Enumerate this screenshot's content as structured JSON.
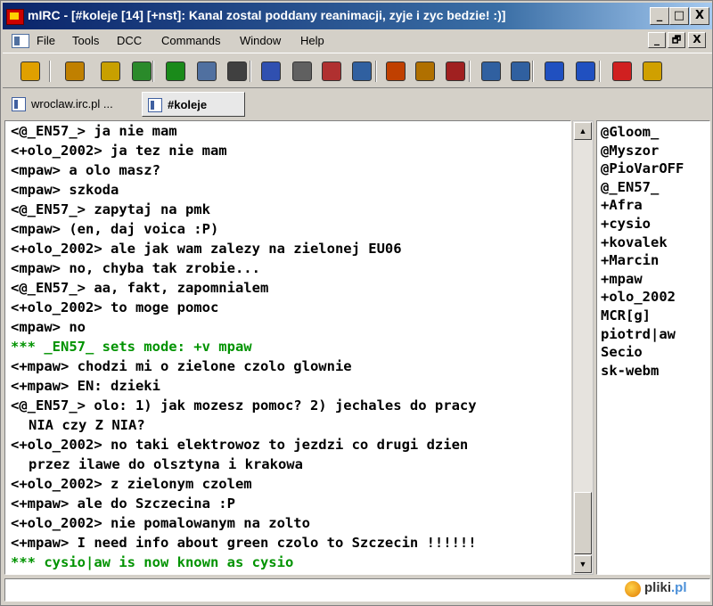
{
  "window": {
    "title": "mIRC - [#koleje [14] [+nst]: Kanal zostal poddany reanimacji, zyje i zyc bedzie! :)]",
    "controls": [
      "_",
      "□",
      "X"
    ],
    "child_controls": [
      "_",
      "🗗",
      "X"
    ]
  },
  "menu": [
    "File",
    "Tools",
    "DCC",
    "Commands",
    "Window",
    "Help"
  ],
  "toolbar": {
    "buttons": [
      {
        "name": "connect-icon",
        "color": "#e0a000"
      },
      {
        "name": "options-icon",
        "color": "#c08000"
      },
      {
        "name": "channels-folder-icon",
        "color": "#c8a000"
      },
      {
        "name": "favorites-icon",
        "color": "#2a8a2a"
      },
      {
        "name": "address-book-icon",
        "color": "#1a8a1a"
      },
      {
        "name": "dcc-send-icon",
        "color": "#5070a0"
      },
      {
        "name": "dcc-chat-icon",
        "color": "#404040"
      },
      {
        "name": "scripts-icon",
        "color": "#3050b0"
      },
      {
        "name": "timer-icon",
        "color": "#606060"
      },
      {
        "name": "colors-icon",
        "color": "#b03030"
      },
      {
        "name": "tile-icon",
        "color": "#3060a0"
      },
      {
        "name": "notify-icon",
        "color": "#c04000"
      },
      {
        "name": "url-list-icon",
        "color": "#b07000"
      },
      {
        "name": "log-icon",
        "color": "#a02020"
      },
      {
        "name": "cascade-icon",
        "color": "#3060a0"
      },
      {
        "name": "arrange-icon",
        "color": "#3060a0"
      },
      {
        "name": "switchbar-icon",
        "color": "#2050c0"
      },
      {
        "name": "windows-icon",
        "color": "#2050c0"
      },
      {
        "name": "help-icon",
        "color": "#d02020"
      },
      {
        "name": "about-icon",
        "color": "#d0a000"
      }
    ]
  },
  "tabs": [
    {
      "label": "wroclaw.irc.pl ...",
      "active": false
    },
    {
      "label": "#koleje",
      "active": true
    }
  ],
  "chat": {
    "lines": [
      {
        "text": "<@_EN57_> ja nie mam",
        "type": "msg"
      },
      {
        "text": "<+olo_2002> ja tez nie mam",
        "type": "msg"
      },
      {
        "text": "<mpaw> a olo masz?",
        "type": "msg"
      },
      {
        "text": "<mpaw> szkoda",
        "type": "msg"
      },
      {
        "text": "<@_EN57_> zapytaj na pmk",
        "type": "msg"
      },
      {
        "text": "<mpaw> (en, daj voica :P)",
        "type": "msg"
      },
      {
        "text": "<+olo_2002> ale jak wam zalezy na zielonej EU06",
        "type": "msg"
      },
      {
        "text": "<mpaw> no, chyba tak zrobie...",
        "type": "msg"
      },
      {
        "text": "<@_EN57_> aa, fakt, zapomnialem",
        "type": "msg"
      },
      {
        "text": "<+olo_2002> to moge pomoc",
        "type": "msg"
      },
      {
        "text": "<mpaw> no",
        "type": "msg"
      },
      {
        "text": "*** _EN57_ sets mode: +v mpaw",
        "type": "sys"
      },
      {
        "text": "<+mpaw> chodzi mi o zielone czolo glownie",
        "type": "msg"
      },
      {
        "text": "<+mpaw> EN: dzieki",
        "type": "msg"
      },
      {
        "text": "<@_EN57_> olo: 1) jak mozesz pomoc? 2) jechales do pracy",
        "type": "msg"
      },
      {
        "text": "NIA czy Z NIA?",
        "type": "wrap"
      },
      {
        "text": "<+olo_2002> no taki elektrowoz to jezdzi co drugi dzien",
        "type": "msg"
      },
      {
        "text": "przez ilawe do olsztyna i krakowa",
        "type": "wrap"
      },
      {
        "text": "<+olo_2002> z zielonym czolem",
        "type": "msg"
      },
      {
        "text": "<+mpaw> ale do Szczecina :P",
        "type": "msg"
      },
      {
        "text": "<+olo_2002> nie pomalowanym na zolto",
        "type": "msg"
      },
      {
        "text": "<+mpaw> I need info about green czolo to Szczecin !!!!!!",
        "type": "msg"
      },
      {
        "text": "*** cysio|aw is now known as cysio",
        "type": "sys"
      }
    ],
    "sys_color": "#009300"
  },
  "nicklist": [
    "@Gloom_",
    "@Myszor",
    "@PioVarOFF",
    "@_EN57_",
    "+Afra",
    "+cysio",
    "+kovalek",
    "+Marcin",
    "+mpaw",
    "+olo_2002",
    "MCR[g]",
    "piotrd|aw",
    "Secio",
    "sk-webm"
  ],
  "input": {
    "value": ""
  },
  "watermark": {
    "text_main": "pliki",
    "text_tld": ".pl"
  }
}
